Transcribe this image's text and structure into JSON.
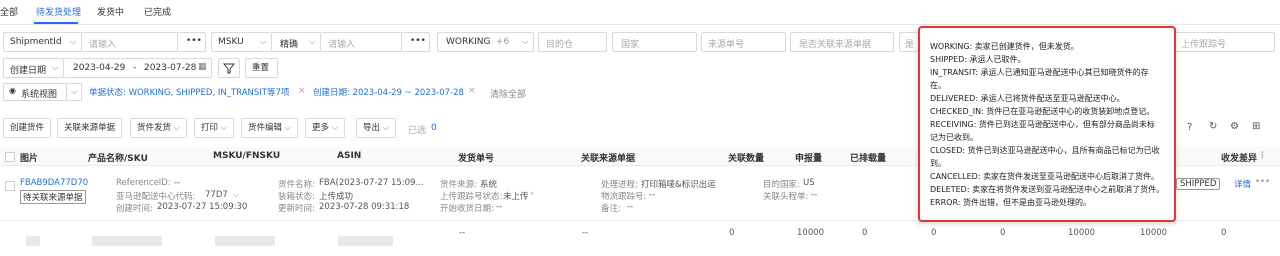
{
  "tabs": [
    {
      "label": "全部"
    },
    {
      "label": "待发货处理"
    },
    {
      "label": "发货中"
    },
    {
      "label": "已完成"
    }
  ],
  "filters": {
    "shipment_field": "ShipmentId",
    "shipment_placeholder": "请输入",
    "msku_field": "MSKU",
    "match_mode": "精确",
    "msku_placeholder": "请输入",
    "status_value": "WORKING",
    "status_more": "+6",
    "destination_placeholder": "目的仓",
    "country_placeholder": "国家",
    "source_no_placeholder": "来源单号",
    "linked_placeholder": "是否关联来源单据",
    "truncated_placeholder": "是",
    "upload_tracking_placeholder": "上传跟踪号",
    "date_field": "创建日期",
    "date_start": "2023-04-29",
    "date_sep": "-",
    "date_end": "2023-07-28",
    "reset_label": "重置"
  },
  "view": {
    "system_view": "系统视图",
    "tag_status": "单据状态: WORKING, SHIPPED, IN_TRANSIT等7项",
    "tag_date": "创建日期: 2023-04-29 ~ 2023-07-28",
    "clear_all": "清除全部"
  },
  "toolbar": {
    "create": "创建货件",
    "link_source": "关联来源单据",
    "ship": "货件发货",
    "print": "打印",
    "edit": "货件编辑",
    "more": "更多",
    "export": "导出",
    "selected_label": "已选",
    "selected_count": "0"
  },
  "columns": [
    "图片",
    "产品名称/SKU",
    "MSKU/FNSKU",
    "ASIN",
    "发货单号",
    "关联来源单据",
    "关联数量",
    "申报量",
    "已排载量",
    "收发差异"
  ],
  "row1": {
    "shipment_id": "FBAB9DA77D70",
    "link_btn": "待关联来源单据",
    "reference_id_label": "ReferenceID:",
    "reference_id": "--",
    "center_label": "亚马逊配送中心代码:",
    "center": "77D7",
    "created_label": "创建时间:",
    "created": "2023-07-27 15:09:30",
    "name_label": "货件名称:",
    "name": "FBA(2023-07-27 15:09...",
    "box_label": "装箱状态:",
    "box": "上传成功",
    "updated_label": "更新时间:",
    "updated": "2023-07-28 09:31:18",
    "source_label": "货件来源:",
    "source": "系统",
    "tracking_label": "上传跟踪号状态:",
    "tracking": "未上传",
    "start_label": "开始收货日期:",
    "start": "--",
    "progress_label": "处理进程:",
    "progress": "打印箱唛&标识出运",
    "logistics_label": "物流跟踪号:",
    "logistics": "--",
    "note_label": "备注:",
    "note": "--",
    "country_label": "目的国家:",
    "country": "US",
    "head_label": "关联头程单:",
    "head": "--",
    "status_badge": "SHIPPED",
    "detail": "详情"
  },
  "row2": {
    "dash": "--",
    "dash2": "--",
    "count1": "0",
    "declared": "10000",
    "loaded": "0",
    "z2": "0",
    "z3": "0",
    "v1": "10000",
    "v2": "10000",
    "z4": "0"
  },
  "tooltip": {
    "lines": [
      "WORKING: 卖家已创建货件，但未发货。",
      "SHIPPED: 承运人已取件。",
      "IN_TRANSIT: 承运人已通知亚马逊配送中心其已知晓货件的存",
      "在。",
      "DELIVERED: 承运人已将货件配送至亚马逊配送中心。",
      "CHECKED_IN: 货件已在亚马逊配送中心的收货装卸地点登记。",
      "RECEIVING: 货件已到达亚马逊配送中心，但有部分商品尚未标",
      "记为已收到。",
      "CLOSED: 货件已到达亚马逊配送中心，且所有商品已标记为已收",
      "到。",
      "CANCELLED: 卖家在货件发送至亚马逊配送中心后取消了货件。",
      "DELETED: 卖家在将货件发送到亚马逊配送中心之前取消了货件。",
      "ERROR: 货件出错，但不是由亚马逊处理的。"
    ]
  }
}
